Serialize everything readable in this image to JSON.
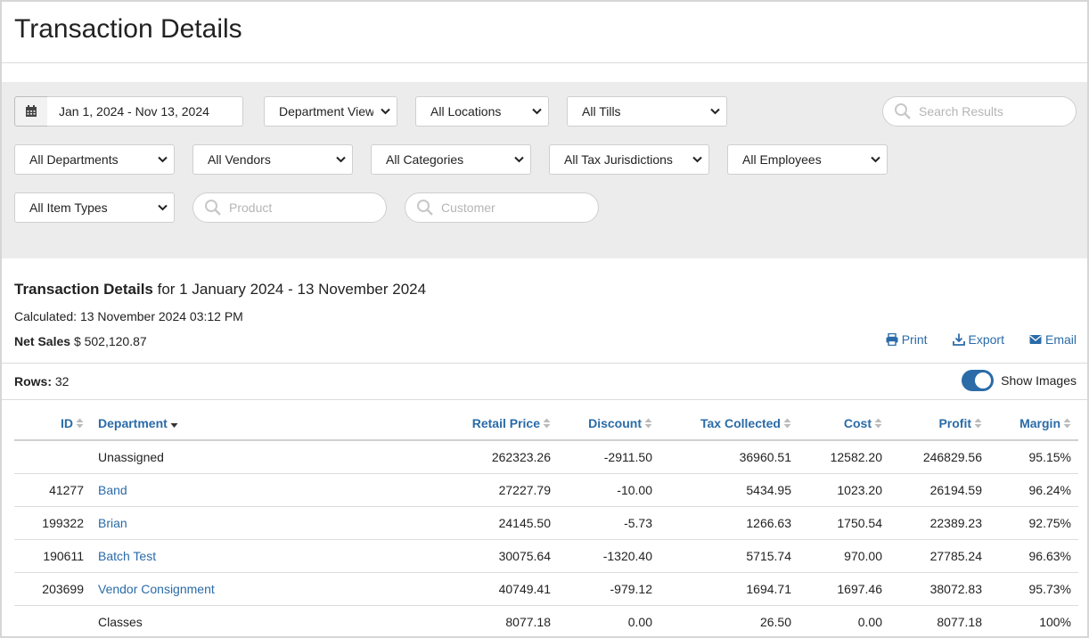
{
  "page": {
    "title": "Transaction Details"
  },
  "filters": {
    "date_range": "Jan 1, 2024 - Nov 13, 2024",
    "view": "Department View",
    "locations": "All Locations",
    "tills": "All Tills",
    "departments": "All Departments",
    "vendors": "All Vendors",
    "categories": "All Categories",
    "tax_jurisdictions": "All Tax Jurisdictions",
    "employees": "All Employees",
    "item_types": "All Item Types",
    "search_results_placeholder": "Search Results",
    "product_placeholder": "Product",
    "customer_placeholder": "Customer"
  },
  "report": {
    "title": "Transaction Details",
    "range_text": "for 1 January 2024 - 13 November 2024",
    "calculated_label": "Calculated:",
    "calculated_value": "13 November 2024 03:12 PM",
    "net_sales_label": "Net Sales",
    "net_sales_value": "$ 502,120.87",
    "rows_label": "Rows:",
    "rows_value": "32",
    "show_images_label": "Show Images",
    "show_images_on": true
  },
  "actions": {
    "print": "Print",
    "export": "Export",
    "email": "Email"
  },
  "table": {
    "headers": {
      "id": "ID",
      "department": "Department",
      "retail_price": "Retail Price",
      "discount": "Discount",
      "tax_collected": "Tax Collected",
      "cost": "Cost",
      "profit": "Profit",
      "margin": "Margin"
    },
    "rows": [
      {
        "id": "",
        "department": "Unassigned",
        "link": false,
        "retail_price": "262323.26",
        "discount": "-2911.50",
        "tax_collected": "36960.51",
        "cost": "12582.20",
        "profit": "246829.56",
        "margin": "95.15%"
      },
      {
        "id": "41277",
        "department": "Band",
        "link": true,
        "retail_price": "27227.79",
        "discount": "-10.00",
        "tax_collected": "5434.95",
        "cost": "1023.20",
        "profit": "26194.59",
        "margin": "96.24%"
      },
      {
        "id": "199322",
        "department": "Brian",
        "link": true,
        "retail_price": "24145.50",
        "discount": "-5.73",
        "tax_collected": "1266.63",
        "cost": "1750.54",
        "profit": "22389.23",
        "margin": "92.75%"
      },
      {
        "id": "190611",
        "department": "Batch Test",
        "link": true,
        "retail_price": "30075.64",
        "discount": "-1320.40",
        "tax_collected": "5715.74",
        "cost": "970.00",
        "profit": "27785.24",
        "margin": "96.63%"
      },
      {
        "id": "203699",
        "department": "Vendor Consignment",
        "link": true,
        "retail_price": "40749.41",
        "discount": "-979.12",
        "tax_collected": "1694.71",
        "cost": "1697.46",
        "profit": "38072.83",
        "margin": "95.73%"
      },
      {
        "id": "",
        "department": "Classes",
        "link": false,
        "retail_price": "8077.18",
        "discount": "0.00",
        "tax_collected": "26.50",
        "cost": "0.00",
        "profit": "8077.18",
        "margin": "100%"
      }
    ]
  },
  "colors": {
    "accent": "#2a6ba8",
    "filter_bg": "#ececec"
  }
}
